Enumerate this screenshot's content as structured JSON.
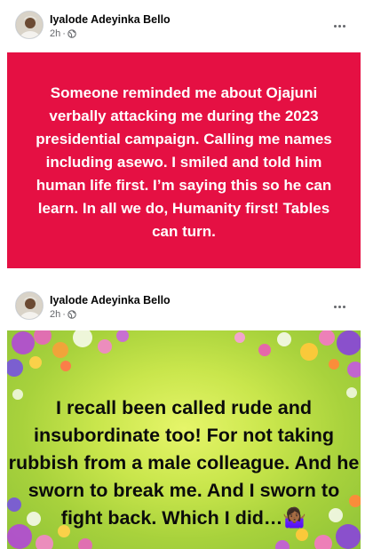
{
  "posts": [
    {
      "author": "Iyalode Adeyinka Bello",
      "time": "2h",
      "separator": "·",
      "privacy_icon": "globe-icon",
      "text": "Someone reminded me about Ojajuni verbally attacking me during the 2023 presidential campaign. Calling me names including asewo. I smiled and told him human life first. I’m saying this so he can learn. In all we do, Humanity first! Tables can turn.",
      "background": "#e51043"
    },
    {
      "author": "Iyalode Adeyinka Bello",
      "time": "2h",
      "separator": "·",
      "privacy_icon": "globe-icon",
      "text": "I recall been called rude and insubordinate too! For not taking rubbish from a male colleague. And he sworn to break me. And I sworn to fight back. Which I did…🤷🏾‍♀️",
      "background": "floral-green"
    }
  ],
  "menu_icon": "more-options-icon"
}
